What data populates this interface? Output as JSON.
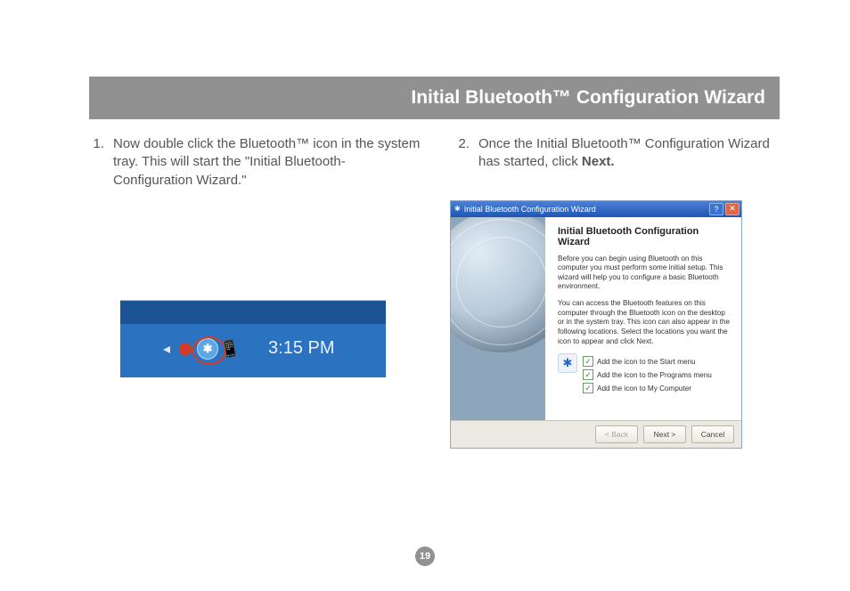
{
  "header": {
    "title": "Initial Bluetooth™ Configuration Wizard"
  },
  "steps": {
    "one": {
      "num": "1.",
      "text": "Now double click the Bluetooth™  icon in the system tray. This will start the \"Initial Bluetooth-Configuration Wizard.\""
    },
    "two": {
      "num": "2.",
      "text_a": "Once the Initial Bluetooth™ Configuration Wizard has started, click ",
      "text_bold": "Next."
    }
  },
  "systray": {
    "arrow_icon": "◂",
    "bluetooth_glyph": "✱",
    "phone_icon": "📱",
    "clock": "3:15 PM"
  },
  "dialog": {
    "title_icon": "✱",
    "title": "Initial Bluetooth Configuration Wizard",
    "help_label": "?",
    "close_label": "✕",
    "heading": "Initial Bluetooth Configuration Wizard",
    "para1": "Before you can begin using Bluetooth on this computer you must perform some initial setup. This wizard will help you to configure a basic Bluetooth environment.",
    "para2": "You can access the Bluetooth features on this computer through the Bluetooth icon on the desktop or in the system tray. This icon can also appear in the following locations. Select the locations you want the icon to appear and click Next.",
    "checks": {
      "c1": "Add the icon to the Start menu",
      "c2": "Add the icon to the Programs menu",
      "c3": "Add the icon to My Computer"
    },
    "buttons": {
      "back": "< Back",
      "next": "Next >",
      "cancel": "Cancel"
    },
    "checkmark": "✓"
  },
  "page_number": "19"
}
